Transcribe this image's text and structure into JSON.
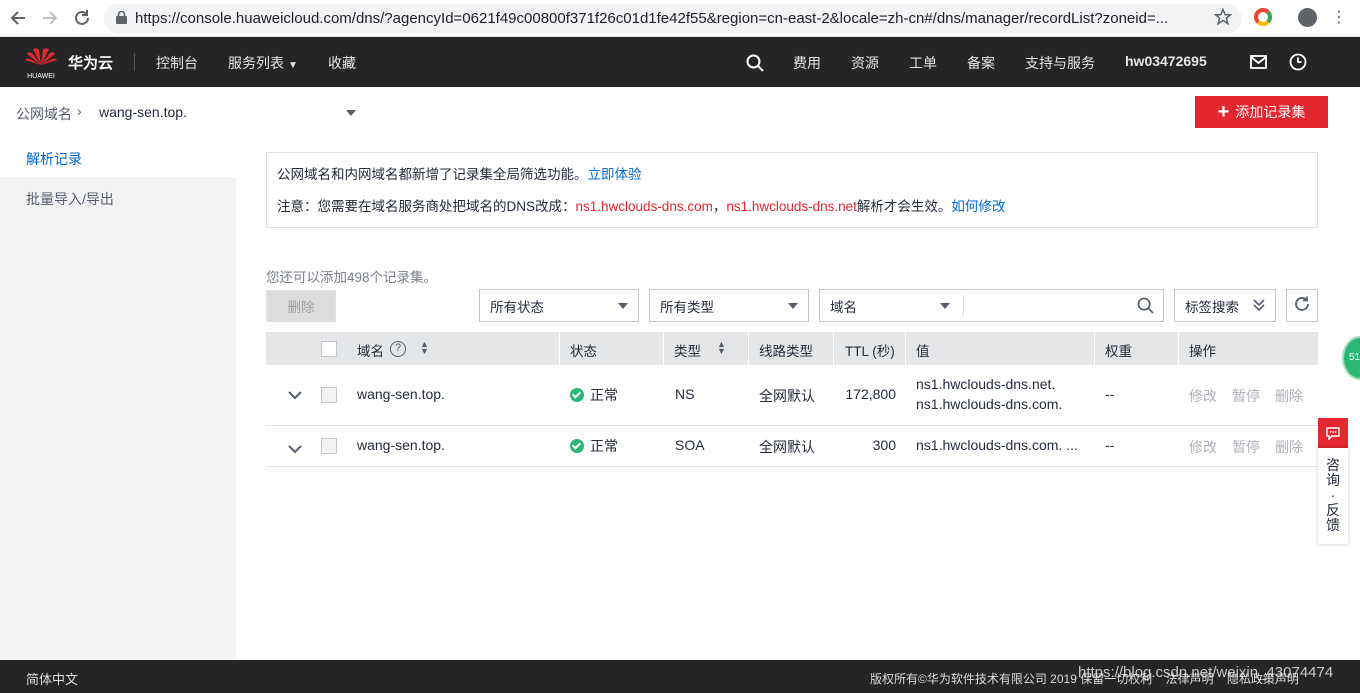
{
  "browser": {
    "url": "https://console.huaweicloud.com/dns/?agencyId=0621f49c00800f371f26c01d1fe42f55&region=cn-east-2&locale=zh-cn#/dns/manager/recordList?zoneid=..."
  },
  "topnav": {
    "brand": "华为云",
    "logo_text": "HUAWEI",
    "left_items": [
      "控制台",
      "服务列表",
      "收藏"
    ],
    "right_items": [
      "费用",
      "资源",
      "工单",
      "备案",
      "支持与服务"
    ],
    "user": "hw03472695"
  },
  "subheader": {
    "breadcrumb_root": "公网域名",
    "breadcrumb_sep": "›",
    "zone": "wang-sen.top.",
    "add_button": "添加记录集"
  },
  "sidebar": {
    "items": [
      {
        "label": "解析记录",
        "active": true
      },
      {
        "label": "批量导入/导出",
        "active": false
      }
    ]
  },
  "notice": {
    "line1_text": "公网域名和内网域名都新增了记录集全局筛选功能。",
    "line1_link": "立即体验",
    "line2_prefix": "注意：您需要在域名服务商处把域名的DNS改成：",
    "ns1": "ns1.hwclouds-dns.com",
    "comma": "，",
    "ns2": "ns1.hwclouds-dns.net",
    "line2_suffix": "解析才会生效。",
    "line2_link": "如何修改"
  },
  "quota_text": "您还可以添加498个记录集。",
  "toolbar": {
    "delete_label": "删除",
    "status_filter": "所有状态",
    "type_filter": "所有类型",
    "search_field": "域名",
    "search_placeholder": "",
    "tag_search": "标签搜索"
  },
  "table": {
    "headers": {
      "domain": "域名",
      "status": "状态",
      "type": "类型",
      "line": "线路类型",
      "ttl": "TTL (秒)",
      "value": "值",
      "weight": "权重",
      "ops": "操作"
    },
    "rows": [
      {
        "domain": "wang-sen.top.",
        "status": "正常",
        "type": "NS",
        "line": "全网默认",
        "ttl": "172,800",
        "value1": "ns1.hwclouds-dns.net.",
        "value2": "ns1.hwclouds-dns.com.",
        "weight": "--",
        "op_edit": "修改",
        "op_pause": "暂停",
        "op_delete": "删除"
      },
      {
        "domain": "wang-sen.top.",
        "status": "正常",
        "type": "SOA",
        "line": "全网默认",
        "ttl": "300",
        "value1": "ns1.hwclouds-dns.com. ...",
        "weight": "--",
        "op_edit": "修改",
        "op_pause": "暂停",
        "op_delete": "删除"
      }
    ]
  },
  "float": {
    "label": "咨询·反馈",
    "chars": [
      "咨",
      "询",
      "·",
      "反",
      "馈"
    ],
    "badge": "51"
  },
  "footer": {
    "lang": "简体中文",
    "copyright": "版权所有©华为软件技术有限公司 2019 保留一切权利    法律声明    隐私政策声明",
    "watermark": "https://blog.csdn.net/weixin_43074474"
  },
  "colors": {
    "brand_red": "#e3262f",
    "link_blue": "#0069d4",
    "status_green": "#2ab773",
    "topbar_bg": "#252525"
  }
}
